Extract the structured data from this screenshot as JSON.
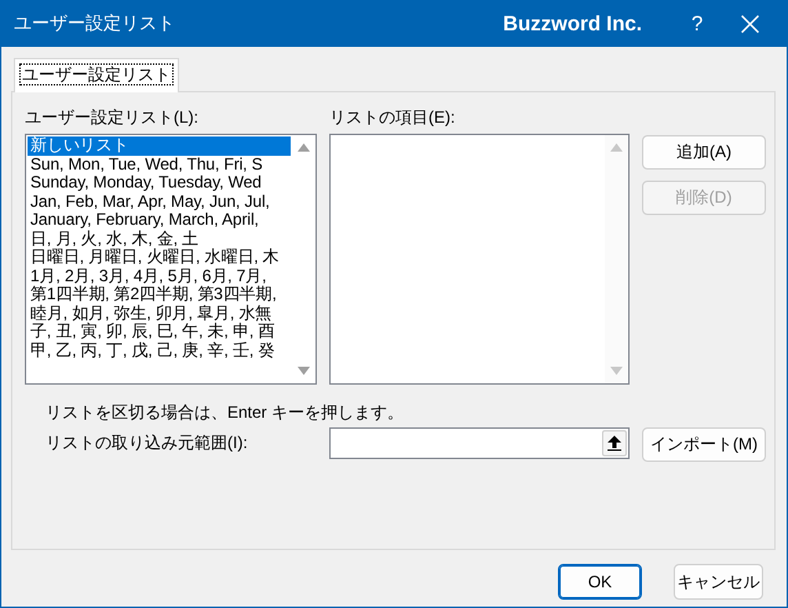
{
  "window": {
    "title": "ユーザー設定リスト",
    "brand": "Buzzword Inc.",
    "help": "?"
  },
  "tabs": [
    {
      "label": "ユーザー設定リスト",
      "selected": true
    }
  ],
  "custom_lists": {
    "label": "ユーザー設定リスト(L):",
    "items": [
      {
        "text": "新しいリスト",
        "selected": true
      },
      {
        "text": "Sun, Mon, Tue, Wed, Thu, Fri, S",
        "selected": false
      },
      {
        "text": "Sunday, Monday, Tuesday, Wed",
        "selected": false
      },
      {
        "text": "Jan, Feb, Mar, Apr, May, Jun, Jul,",
        "selected": false
      },
      {
        "text": "January, February, March, April,",
        "selected": false
      },
      {
        "text": "日, 月, 火, 水, 木, 金, 土",
        "selected": false
      },
      {
        "text": "日曜日, 月曜日, 火曜日, 水曜日, 木",
        "selected": false
      },
      {
        "text": "1月, 2月, 3月, 4月, 5月, 6月, 7月,",
        "selected": false
      },
      {
        "text": "第1四半期, 第2四半期, 第3四半期,",
        "selected": false
      },
      {
        "text": "睦月, 如月, 弥生, 卯月, 皐月, 水無",
        "selected": false
      },
      {
        "text": "子, 丑, 寅, 卯, 辰, 巳, 午, 未, 申, 酉",
        "selected": false
      },
      {
        "text": "甲, 乙, 丙, 丁, 戊, 己, 庚, 辛, 壬, 癸",
        "selected": false
      }
    ]
  },
  "list_entries": {
    "label": "リストの項目(E):"
  },
  "side_buttons": [
    {
      "label": "追加(A)",
      "disabled": false
    },
    {
      "label": "削除(D)",
      "disabled": true
    }
  ],
  "hint": "リストを区切る場合は、Enter キーを押します。",
  "import": {
    "label": "リストの取り込み元範囲(I):",
    "button": "インポート(M)"
  },
  "footer_buttons": [
    {
      "label": "OK",
      "default": true
    },
    {
      "label": "キャンセル",
      "default": false
    }
  ]
}
